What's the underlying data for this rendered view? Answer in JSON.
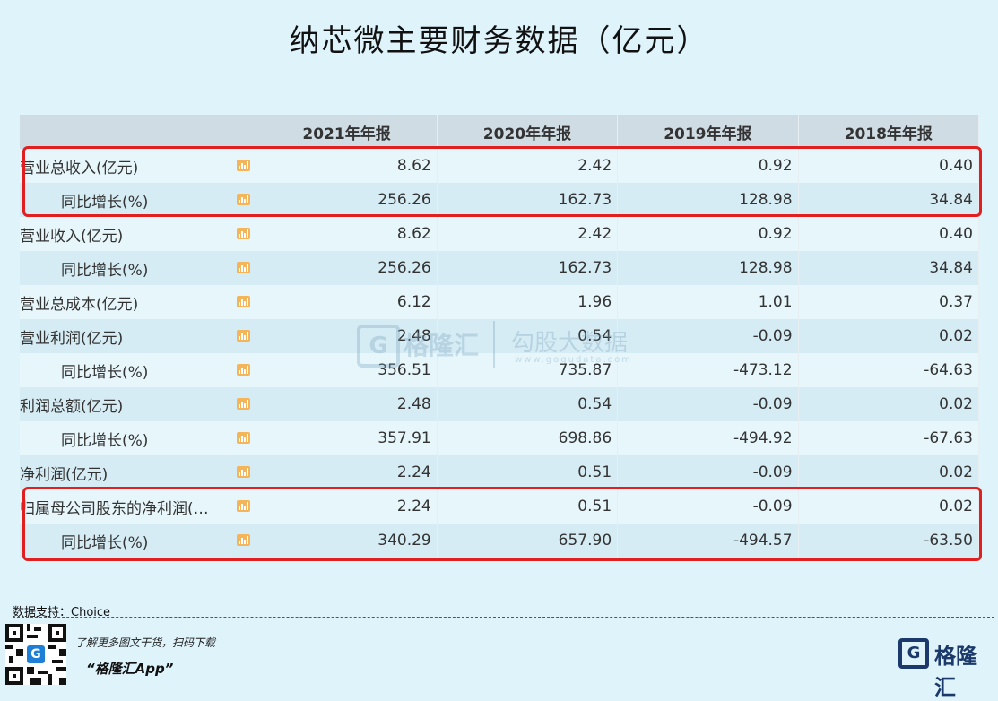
{
  "title": "纳芯微主要财务数据（亿元）",
  "header": {
    "columns": [
      "",
      "2021年年报",
      "2020年年报",
      "2019年年报",
      "2018年年报"
    ]
  },
  "rows": [
    {
      "label": "营业总收入(亿元)",
      "indent": false,
      "values": [
        "8.62",
        "2.42",
        "0.92",
        "0.40"
      ]
    },
    {
      "label": "同比增长(%)",
      "indent": true,
      "values": [
        "256.26",
        "162.73",
        "128.98",
        "34.84"
      ]
    },
    {
      "label": "营业收入(亿元)",
      "indent": false,
      "values": [
        "8.62",
        "2.42",
        "0.92",
        "0.40"
      ]
    },
    {
      "label": "同比增长(%)",
      "indent": true,
      "values": [
        "256.26",
        "162.73",
        "128.98",
        "34.84"
      ]
    },
    {
      "label": "营业总成本(亿元)",
      "indent": false,
      "values": [
        "6.12",
        "1.96",
        "1.01",
        "0.37"
      ]
    },
    {
      "label": "营业利润(亿元)",
      "indent": false,
      "values": [
        "2.48",
        "0.54",
        "-0.09",
        "0.02"
      ]
    },
    {
      "label": "同比增长(%)",
      "indent": true,
      "values": [
        "356.51",
        "735.87",
        "-473.12",
        "-64.63"
      ]
    },
    {
      "label": "利润总额(亿元)",
      "indent": false,
      "values": [
        "2.48",
        "0.54",
        "-0.09",
        "0.02"
      ]
    },
    {
      "label": "同比增长(%)",
      "indent": true,
      "values": [
        "357.91",
        "698.86",
        "-494.92",
        "-67.63"
      ]
    },
    {
      "label": "净利润(亿元)",
      "indent": false,
      "values": [
        "2.24",
        "0.51",
        "-0.09",
        "0.02"
      ]
    },
    {
      "label": "归属母公司股东的净利润(…",
      "indent": false,
      "values": [
        "2.24",
        "0.51",
        "-0.09",
        "0.02"
      ]
    },
    {
      "label": "同比增长(%)",
      "indent": true,
      "values": [
        "340.29",
        "657.90",
        "-494.57",
        "-63.50"
      ]
    }
  ],
  "watermark": {
    "logo_letter": "G",
    "brand": "格隆汇",
    "name": "勾股大数据",
    "url": "www.gogudata.com"
  },
  "footer": {
    "source": "数据支持：Choice",
    "promo_line1": "了解更多图文干货，扫码下载",
    "promo_line2": "“格隆汇App”",
    "qr_letter": "G",
    "logo_letter": "G",
    "logo_text": "格隆汇"
  },
  "colors": {
    "background": "#dff3fb",
    "highlight": "#e02020",
    "chart_icon": "#f4b55a",
    "brand": "#1b3a6b"
  }
}
